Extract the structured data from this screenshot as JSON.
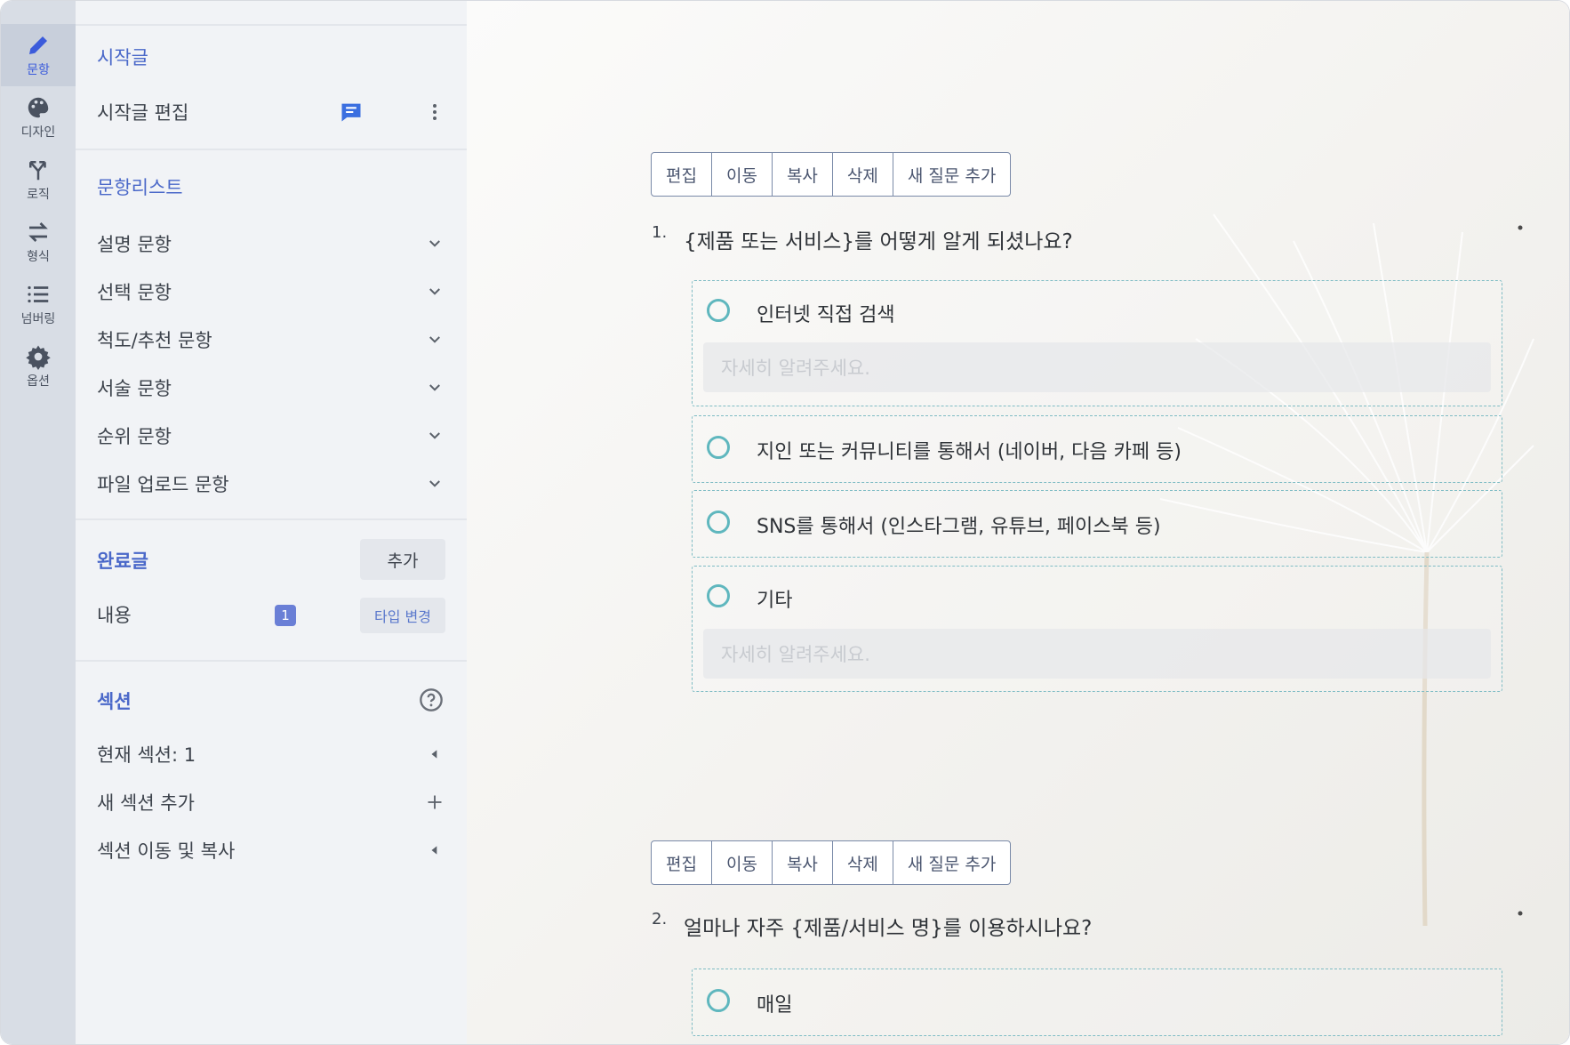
{
  "rail": [
    {
      "label": "문항",
      "icon": "pencil-icon"
    },
    {
      "label": "디자인",
      "icon": "palette-icon"
    },
    {
      "label": "로직",
      "icon": "logic-icon"
    },
    {
      "label": "형식",
      "icon": "swap-icon"
    },
    {
      "label": "넘버링",
      "icon": "list-icon"
    },
    {
      "label": "옵션",
      "icon": "gear-icon"
    }
  ],
  "panel": {
    "intro_head": "시작글",
    "intro_edit": "시작글 편집",
    "list_head": "문항리스트",
    "question_types": [
      "설명 문항",
      "선택 문항",
      "척도/추천 문항",
      "서술 문항",
      "순위 문항",
      "파일 업로드 문항"
    ],
    "complete_head": "완료글",
    "add_label": "추가",
    "content_label": "내용",
    "content_badge": "1",
    "type_change": "타입 변경",
    "section_head": "섹션",
    "section_rows": [
      "현재 섹션: 1",
      "새 섹션 추가",
      "섹션 이동 및 복사"
    ]
  },
  "toolbar": [
    "편집",
    "이동",
    "복사",
    "삭제",
    "새 질문 추가"
  ],
  "questions": [
    {
      "num": "1.",
      "text": "{제품 또는 서비스}를 어떻게 알게 되셨나요?",
      "options": [
        {
          "label": "인터넷 직접 검색",
          "detail": "자세히 알려주세요."
        },
        {
          "label": "지인 또는 커뮤니티를 통해서 (네이버, 다음 카페 등)"
        },
        {
          "label": "SNS를 통해서 (인스타그램, 유튜브, 페이스북 등)"
        },
        {
          "label": "기타",
          "detail": "자세히 알려주세요."
        }
      ]
    },
    {
      "num": "2.",
      "text": "얼마나 자주 {제품/서비스 명}를 이용하시나요?",
      "options": [
        {
          "label": "매일"
        }
      ]
    }
  ]
}
